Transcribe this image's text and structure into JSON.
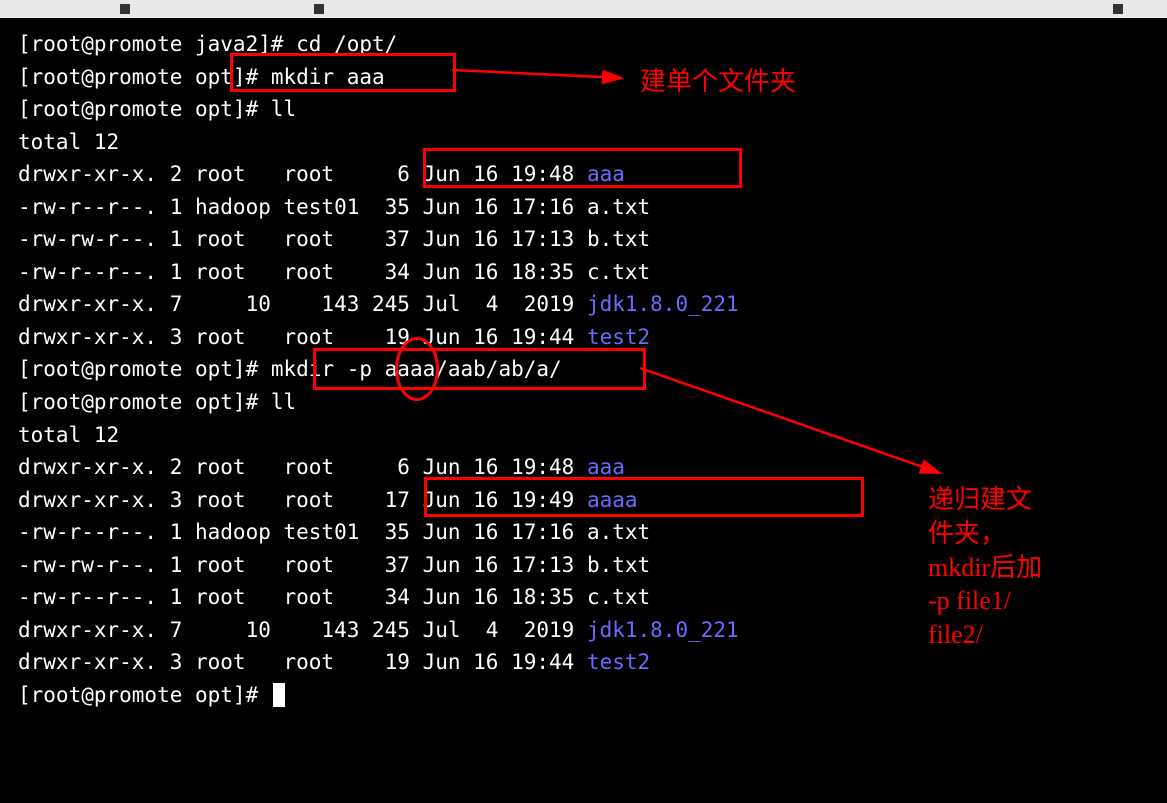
{
  "tabs": {
    "left": " ",
    "mid": " ",
    "right": " "
  },
  "prompts": {
    "p1": "[root@promote java2]# ",
    "p2": "[root@promote opt]# "
  },
  "cmds": {
    "cd": "cd /opt/",
    "mkdir1": "mkdir aaa",
    "ll": "ll",
    "mkdirp": "mkdir -p aaaa/aab/ab/a/"
  },
  "listing1": {
    "total": "total 12",
    "r0": {
      "perm": "drwxr-xr-x. 2 root   root     6 Jun 16 19:48 ",
      "name": "aaa"
    },
    "r1": "-rw-r--r--. 1 hadoop test01  35 Jun 16 17:16 a.txt",
    "r2": "-rw-rw-r--. 1 root   root    37 Jun 16 17:13 b.txt",
    "r3": "-rw-r--r--. 1 root   root    34 Jun 16 18:35 c.txt",
    "r4": {
      "perm": "drwxr-xr-x. 7     10    143 245 Jul  4  2019 ",
      "name": "jdk1.8.0_221"
    },
    "r5": {
      "perm": "drwxr-xr-x. 3 root   root    19 Jun 16 19:44 ",
      "name": "test2"
    }
  },
  "listing2": {
    "total": "total 12",
    "r0": {
      "perm": "drwxr-xr-x. 2 root   root     6 Jun 16 19:48 ",
      "name": "aaa"
    },
    "r1": {
      "perm": "drwxr-xr-x. 3 root   root    17 Jun 16 19:49 ",
      "name": "aaaa"
    },
    "r2": "-rw-r--r--. 1 hadoop test01  35 Jun 16 17:16 a.txt",
    "r3": "-rw-rw-r--. 1 root   root    37 Jun 16 17:13 b.txt",
    "r4": "-rw-r--r--. 1 root   root    34 Jun 16 18:35 c.txt",
    "r5": {
      "perm": "drwxr-xr-x. 7     10    143 245 Jul  4  2019 ",
      "name": "jdk1.8.0_221"
    },
    "r6": {
      "perm": "drwxr-xr-x. 3 root   root    19 Jun 16 19:44 ",
      "name": "test2"
    }
  },
  "annotations": {
    "single": "建单个文件夹",
    "recursive": "递归建文\n件夹，\nmkdir后加\n-p file1/\nfile2/"
  }
}
